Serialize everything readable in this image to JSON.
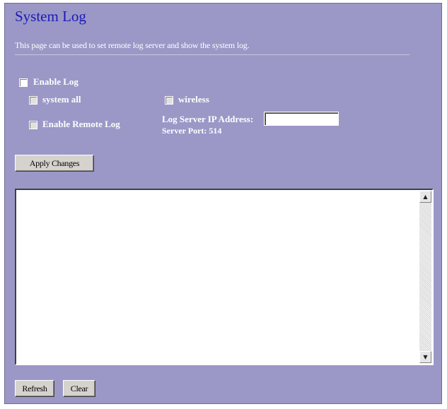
{
  "page": {
    "title": "System Log",
    "description": "This page can be used to set remote log server and show the system log."
  },
  "options": {
    "enable_log": {
      "label": "Enable Log",
      "checked": false
    },
    "system_all": {
      "label": "system all",
      "checked": false
    },
    "wireless": {
      "label": "wireless",
      "checked": false
    },
    "enable_remote_log": {
      "label": "Enable Remote Log",
      "checked": false
    }
  },
  "remote": {
    "ip_label": "Log Server IP Address:",
    "ip_value": "",
    "port_text": "Server Port: 514"
  },
  "buttons": {
    "apply": "Apply Changes",
    "refresh": "Refresh",
    "clear": "Clear"
  },
  "log": {
    "content": ""
  },
  "icons": {
    "scroll_up": "up-arrow-icon",
    "scroll_down": "down-arrow-icon"
  },
  "colors": {
    "background": "#9b98c7",
    "title": "#1c1ab8",
    "text": "#ffffff"
  }
}
